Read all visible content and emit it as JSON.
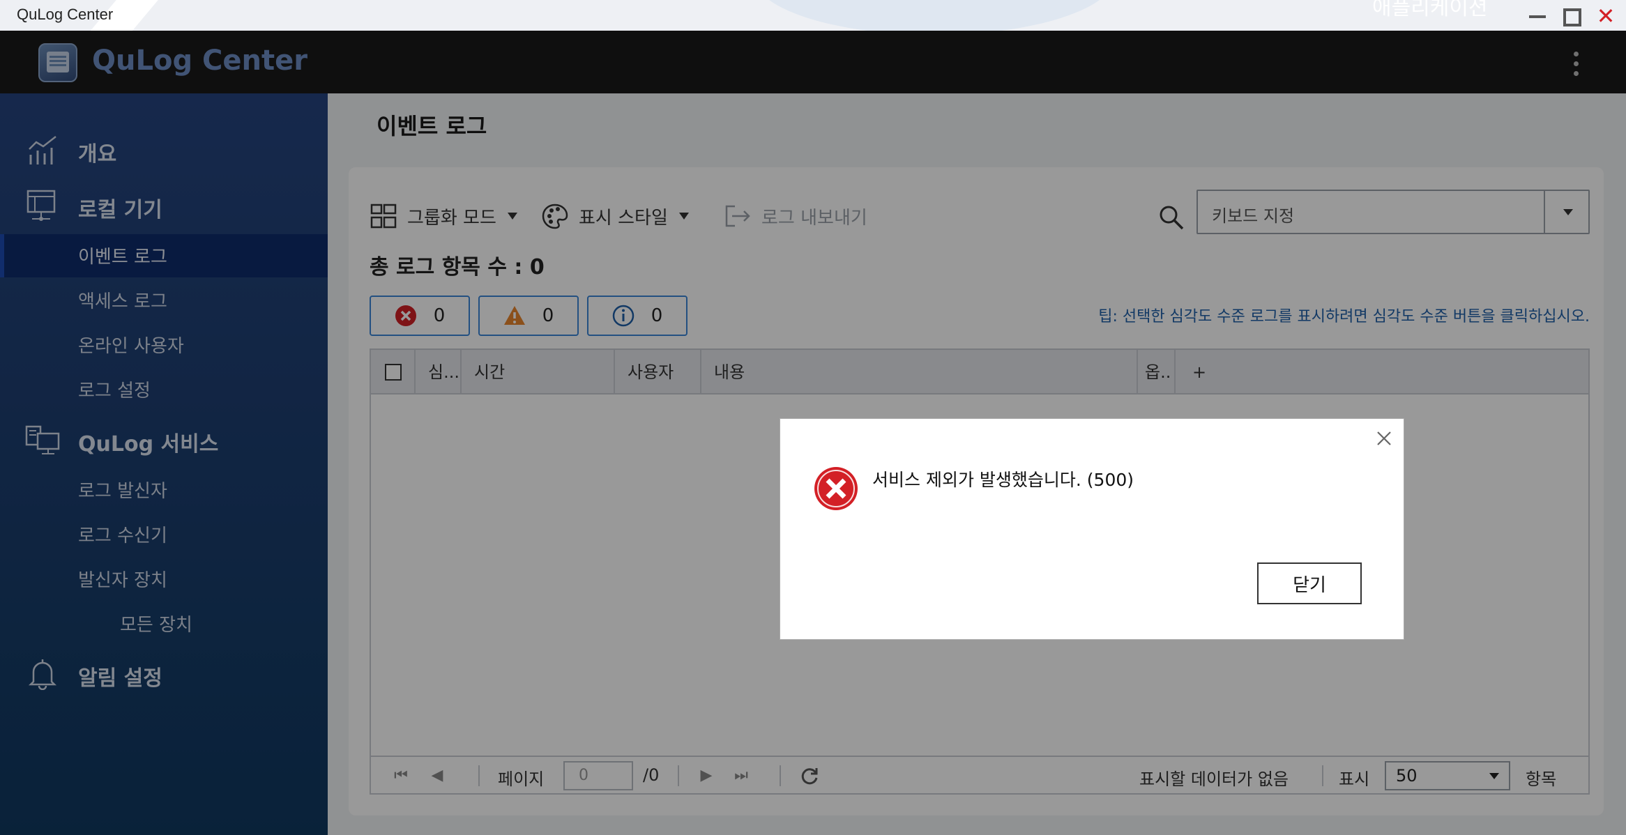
{
  "window": {
    "title": "QuLog Center",
    "background_title": "애플리케이션",
    "close_glyph": "✕"
  },
  "header": {
    "app_name": "QuLog Center"
  },
  "sidebar": {
    "overview": "개요",
    "local_device": "로컬 기기",
    "event_log": "이벤트 로그",
    "access_log": "액세스 로그",
    "online_users": "온라인 사용자",
    "log_settings": "로그 설정",
    "qulog_service": "QuLog 서비스",
    "log_sender": "로그 발신자",
    "log_receiver": "로그 수신기",
    "sender_devices": "발신자 장치",
    "all_devices": "모든 장치",
    "notification_settings": "알림 설정"
  },
  "main": {
    "page_title": "이벤트 로그",
    "toolbar": {
      "group_mode": "그룹화 모드",
      "display_style": "표시 스타일",
      "export_log": "로그 내보내기"
    },
    "search": {
      "placeholder": "키보드 지정"
    },
    "total_count": "총 로그 항목 수 : 0",
    "severity": {
      "error_count": "0",
      "warning_count": "0",
      "info_count": "0"
    },
    "tip": "팁: 선택한 심각도 수준 로그를 표시하려면 심각도 수준 버튼을 클릭하십시오.",
    "table": {
      "columns": [
        "심...",
        "시간",
        "사용자",
        "내용",
        "옵..",
        "+"
      ]
    },
    "pagination": {
      "page_label": "페이지",
      "page_value": "0",
      "page_total": "/0",
      "no_data": "표시할 데이터가 없음",
      "show_label": "표시",
      "per_page": "50",
      "items_label": "항목"
    }
  },
  "dialog": {
    "message": "서비스 제외가 발생했습니다. (500)",
    "close_label": "닫기"
  },
  "colors": {
    "sidebar_top": "#25447f",
    "sidebar_bottom": "#103960",
    "accent_blue": "#3b86d8",
    "error_red": "#d32026",
    "warning_orange": "#e8862e"
  }
}
